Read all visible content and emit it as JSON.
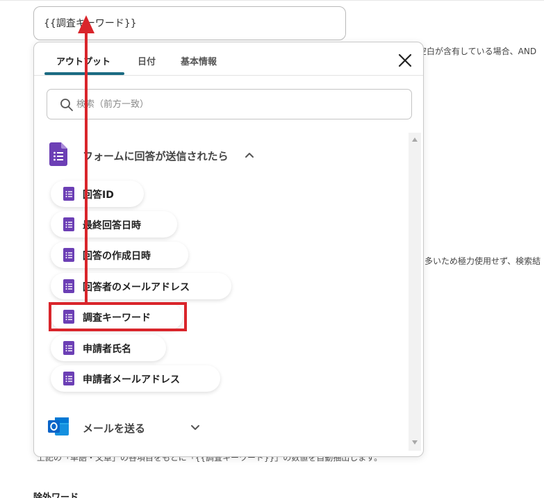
{
  "background": {
    "note1": "空白が含有している場合、AND",
    "note2": "多いため極力使用せず、検索結",
    "note3": "上記の「単語・文章」の各項目をもとに「{{調査キーワード}}」の数値を自動抽出します。",
    "heading": "除外ワード"
  },
  "keyword_input": {
    "value": "{{調査キーワード}}"
  },
  "popup": {
    "tabs": [
      "アウトプット",
      "日付",
      "基本情報"
    ],
    "search": {
      "placeholder": "検索（前方一致）"
    },
    "groups": [
      {
        "title": "フォームに回答が送信されたら",
        "icon": "google-forms-icon",
        "items": [
          "回答ID",
          "最終回答日時",
          "回答の作成日時",
          "回答者のメールアドレス",
          "調査キーワード",
          "申請者氏名",
          "申請者メールアドレス"
        ]
      },
      {
        "title": "メールを送る",
        "icon": "outlook-icon"
      }
    ]
  },
  "colors": {
    "accent": "#1b6b82",
    "forms_purple": "#6c3fb5",
    "outlook_blue": "#0a64c8",
    "highlight_red": "#d9252b"
  }
}
